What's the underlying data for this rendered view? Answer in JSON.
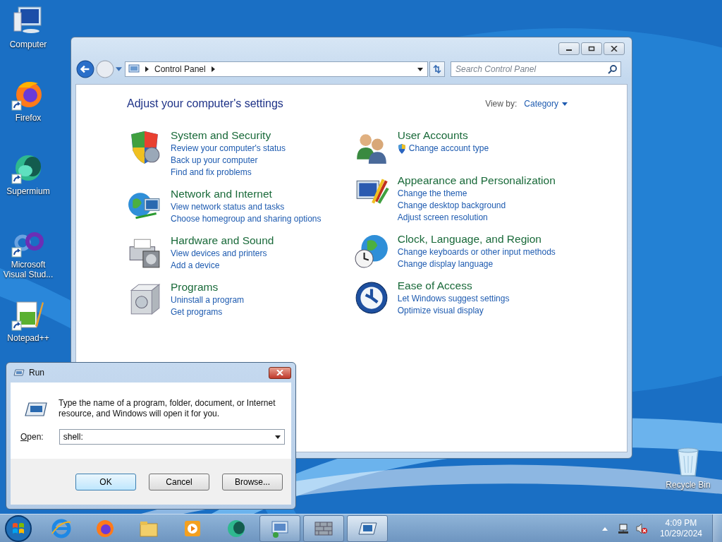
{
  "desktop_icons": [
    {
      "label": "Computer",
      "shortcut": false
    },
    {
      "label": "Firefox",
      "shortcut": true
    },
    {
      "label": "Supermium",
      "shortcut": true
    },
    {
      "label": "Microsoft Visual Stud...",
      "shortcut": true
    },
    {
      "label": "Notepad++",
      "shortcut": true
    }
  ],
  "recycle_bin": {
    "label": "Recycle Bin"
  },
  "control_panel": {
    "breadcrumb": "Control Panel",
    "search": {
      "placeholder": "Search Control Panel"
    },
    "heading": "Adjust your computer's settings",
    "view_by": {
      "label": "View by:",
      "value": "Category"
    },
    "left_categories": [
      {
        "title": "System and Security",
        "links": [
          {
            "text": "Review your computer's status",
            "shield": false
          },
          {
            "text": "Back up your computer",
            "shield": false
          },
          {
            "text": "Find and fix problems",
            "shield": false
          }
        ]
      },
      {
        "title": "Network and Internet",
        "links": [
          {
            "text": "View network status and tasks",
            "shield": false
          },
          {
            "text": "Choose homegroup and sharing options",
            "shield": false
          }
        ]
      },
      {
        "title": "Hardware and Sound",
        "links": [
          {
            "text": "View devices and printers",
            "shield": false
          },
          {
            "text": "Add a device",
            "shield": false
          }
        ]
      },
      {
        "title": "Programs",
        "links": [
          {
            "text": "Uninstall a program",
            "shield": false
          },
          {
            "text": "Get programs",
            "shield": false
          }
        ]
      }
    ],
    "right_categories": [
      {
        "title": "User Accounts",
        "links": [
          {
            "text": "Change account type",
            "shield": true
          }
        ]
      },
      {
        "title": "Appearance and Personalization",
        "links": [
          {
            "text": "Change the theme",
            "shield": false
          },
          {
            "text": "Change desktop background",
            "shield": false
          },
          {
            "text": "Adjust screen resolution",
            "shield": false
          }
        ]
      },
      {
        "title": "Clock, Language, and Region",
        "links": [
          {
            "text": "Change keyboards or other input methods",
            "shield": false
          },
          {
            "text": "Change display language",
            "shield": false
          }
        ]
      },
      {
        "title": "Ease of Access",
        "links": [
          {
            "text": "Let Windows suggest settings",
            "shield": false
          },
          {
            "text": "Optimize visual display",
            "shield": false
          }
        ]
      }
    ]
  },
  "run_dialog": {
    "title": "Run",
    "description": "Type the name of a program, folder, document, or Internet resource, and Windows will open it for you.",
    "open_label": "Open:",
    "value": "shell:",
    "buttons": [
      {
        "label": "OK",
        "default": true
      },
      {
        "label": "Cancel",
        "default": false
      },
      {
        "label": "Browse...",
        "default": false
      }
    ]
  },
  "taskbar": {
    "items": [
      {
        "running": false,
        "active": false
      },
      {
        "running": false,
        "active": false
      },
      {
        "running": false,
        "active": false
      },
      {
        "running": false,
        "active": false
      },
      {
        "running": false,
        "active": false
      },
      {
        "running": true,
        "active": false
      },
      {
        "running": true,
        "active": false
      },
      {
        "running": true,
        "active": true
      }
    ],
    "time": "4:09 PM",
    "date": "10/29/2024"
  }
}
